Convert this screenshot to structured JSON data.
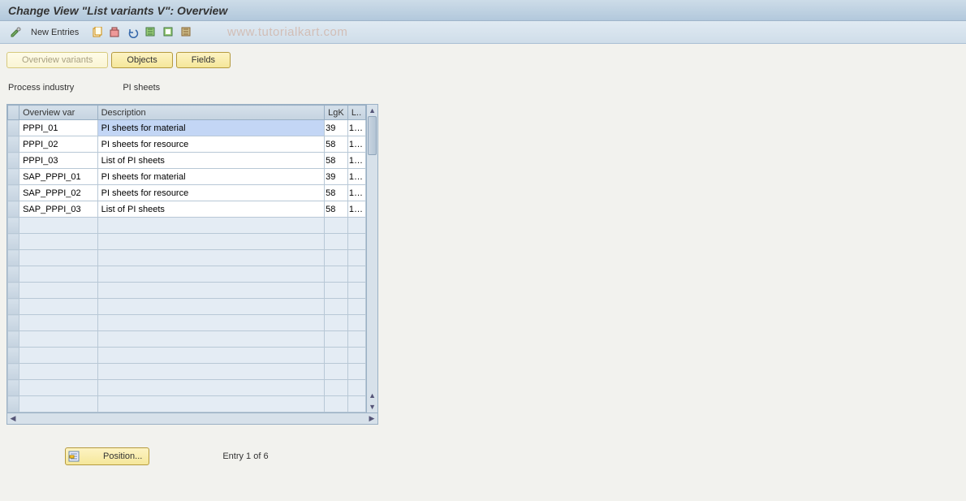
{
  "title": "Change View \"List variants                  V\": Overview",
  "toolbar": {
    "new_entries_label": "New Entries"
  },
  "watermark": "www.tutorialkart.com",
  "tabs": {
    "overview": "Overview variants",
    "objects": "Objects",
    "fields": "Fields"
  },
  "context": {
    "label": "Process industry",
    "value": "PI sheets"
  },
  "columns": {
    "sel": "",
    "overview_var": "Overview var",
    "description": "Description",
    "lgk": "LgK",
    "l": "L.."
  },
  "rows": [
    {
      "ov": "PPPI_01",
      "desc": "PI sheets for material",
      "lgk": "39",
      "l": "1…",
      "selected": true
    },
    {
      "ov": "PPPI_02",
      "desc": "PI sheets for resource",
      "lgk": "58",
      "l": "1…"
    },
    {
      "ov": "PPPI_03",
      "desc": "List of PI sheets",
      "lgk": "58",
      "l": "1…"
    },
    {
      "ov": "SAP_PPPI_01",
      "desc": "PI sheets for material",
      "lgk": "39",
      "l": "1…"
    },
    {
      "ov": "SAP_PPPI_02",
      "desc": "PI sheets for resource",
      "lgk": "58",
      "l": "1…"
    },
    {
      "ov": "SAP_PPPI_03",
      "desc": "List of PI sheets",
      "lgk": "58",
      "l": "1…"
    }
  ],
  "empty_row_count": 12,
  "footer": {
    "position_label": "Position...",
    "entry_text": "Entry 1 of 6"
  }
}
